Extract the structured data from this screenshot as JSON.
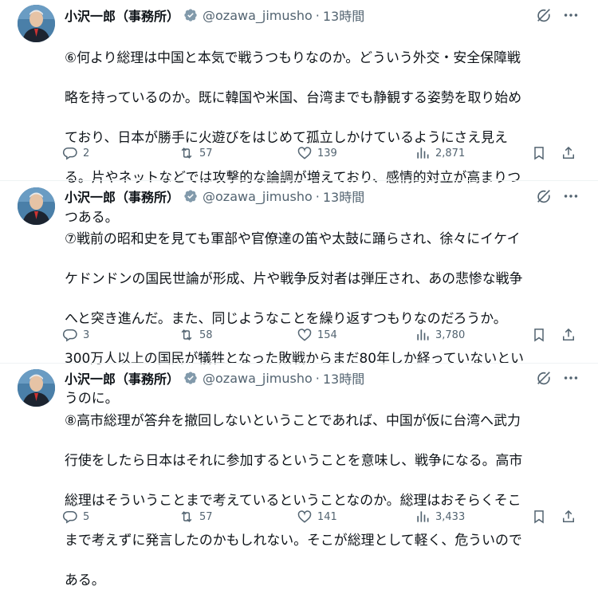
{
  "colors": {
    "text": "#0f1419",
    "secondary": "#536471",
    "verified": "#829aab",
    "divider": "#eff3f4"
  },
  "icons": {
    "verified": "verified-badge-icon",
    "grok": "grok-icon",
    "more": "more-icon",
    "reply": "reply-icon",
    "retweet": "retweet-icon",
    "like": "like-icon",
    "views": "views-icon",
    "bookmark": "bookmark-icon",
    "share": "share-icon"
  },
  "tweets": [
    {
      "name": "小沢一郎（事務所）",
      "handle": "@ozawa_jimusho",
      "dot": "·",
      "time": "13時間",
      "lines": [
        "⑥何より総理は中国と本気で戦うつもりなのか。どういう外交・安全保障戦",
        "略を持っているのか。既に韓国や米国、台湾までも静観する姿勢を取り始め",
        "ており、日本が勝手に火遊びをはじめて孤立しかけているようにさえ見え",
        "る。片やネットなどでは攻撃的な論調が増えており、感情的対立が高まりつ",
        "つある。"
      ],
      "replies": "2",
      "retweets": "57",
      "likes": "139",
      "views": "2,871"
    },
    {
      "name": "小沢一郎（事務所）",
      "handle": "@ozawa_jimusho",
      "dot": "·",
      "time": "13時間",
      "lines": [
        "⑦戦前の昭和史を見ても軍部や官僚達の笛や太鼓に踊らされ、徐々にイケイ",
        "ケドンドンの国民世論が形成、片や戦争反対者は弾圧され、あの悲惨な戦争",
        "へと突き進んだ。また、同じようなことを繰り返すつもりなのだろうか。",
        "300万人以上の国民が犠牲となった敗戦からまだ80年しか経っていないとい",
        "うのに。"
      ],
      "replies": "3",
      "retweets": "58",
      "likes": "154",
      "views": "3,780"
    },
    {
      "name": "小沢一郎（事務所）",
      "handle": "@ozawa_jimusho",
      "dot": "·",
      "time": "13時間",
      "lines": [
        "⑧高市総理が答弁を撤回しないということであれば、中国が仮に台湾へ武力",
        "行使をしたら日本はそれに参加するということを意味し、戦争になる。高市",
        "総理はそういうことまで考えているということなのか。総理はおそらくそこ",
        "まで考えずに発言したのかもしれない。そこが総理として軽く、危ういので",
        "ある。"
      ],
      "replies": "5",
      "retweets": "57",
      "likes": "141",
      "views": "3,433"
    }
  ]
}
